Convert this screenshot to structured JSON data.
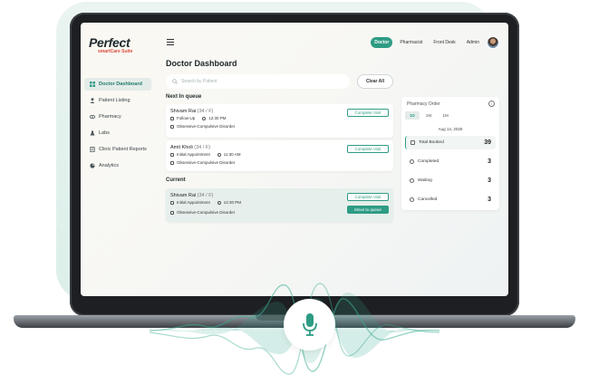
{
  "logo": {
    "brand": "Perfect",
    "tagline": "smartCare Suite"
  },
  "sidebar": {
    "items": [
      {
        "label": "Doctor Dashboard",
        "icon": "grid-icon",
        "active": true
      },
      {
        "label": "Patient Listing",
        "icon": "user-icon",
        "active": false
      },
      {
        "label": "Pharmacy",
        "icon": "pill-icon",
        "active": false
      },
      {
        "label": "Labs",
        "icon": "flask-icon",
        "active": false
      },
      {
        "label": "Clinic Patient Reports",
        "icon": "report-icon",
        "active": false
      },
      {
        "label": "Analytics",
        "icon": "pie-chart-icon",
        "active": false
      }
    ]
  },
  "header": {
    "nav": [
      {
        "label": "Doctor",
        "active": true
      },
      {
        "label": "Pharmacist",
        "active": false
      },
      {
        "label": "Front Desk",
        "active": false
      },
      {
        "label": "Admin",
        "active": false
      }
    ]
  },
  "main": {
    "title": "Doctor Dashboard",
    "search_placeholder": "Search by Patient",
    "clear_all": "Clear All",
    "queue_label": "Next In queue",
    "current_label": "Current",
    "queue": [
      {
        "name": "Shivam Rai",
        "meta": "(34 / F)",
        "visit": "Follow-Up",
        "time": "12:30 PM",
        "diagnosis": "Obsessive-Compulsive Disorder",
        "action": "Complete Visit"
      },
      {
        "name": "Amit Kholi",
        "meta": "(34 / F)",
        "visit": "Initial Appointment",
        "time": "11:30 AM",
        "diagnosis": "Obsessive-Compulsive Disorder",
        "action": "Complete Visit"
      }
    ],
    "current": {
      "name": "Shivam Rai",
      "meta": "(34 / F)",
      "visit": "Initial Appointment",
      "time": "12:30 PM",
      "diagnosis": "Obsessive-Compulsive Disorder",
      "action": "Complete Visit",
      "secondary_action": "Move to queue"
    }
  },
  "pharmacy": {
    "title": "Pharmacy Order",
    "tabs": [
      {
        "label": "1D",
        "active": true
      },
      {
        "label": "1W",
        "active": false
      },
      {
        "label": "1M",
        "active": false
      }
    ],
    "date": "Aug 14, 2025",
    "stats": [
      {
        "label": "Total Booked",
        "value": "39"
      },
      {
        "label": "Completed",
        "value": "3"
      },
      {
        "label": "Waiting",
        "value": "3"
      },
      {
        "label": "Cancelled",
        "value": "3"
      }
    ]
  },
  "colors": {
    "accent": "#2e9c84",
    "brand_red": "#d94a3a",
    "wave": "#3fae95"
  }
}
